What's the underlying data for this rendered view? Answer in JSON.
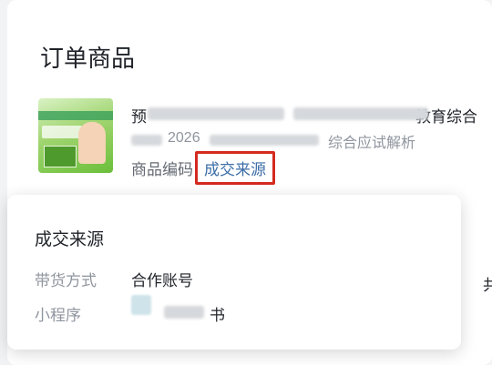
{
  "section": {
    "title": "订单商品"
  },
  "product": {
    "title_start": "预",
    "title_end": "教育综合",
    "subtitle_middle": "2026",
    "subtitle_end": "综合应试解析",
    "code_label": "商品编码",
    "source_link": "成交来源"
  },
  "right_edge_char": "共",
  "popover": {
    "title": "成交来源",
    "rows": [
      {
        "label": "带货方式",
        "value": "合作账号"
      },
      {
        "label": "小程序",
        "value": "书"
      }
    ]
  }
}
